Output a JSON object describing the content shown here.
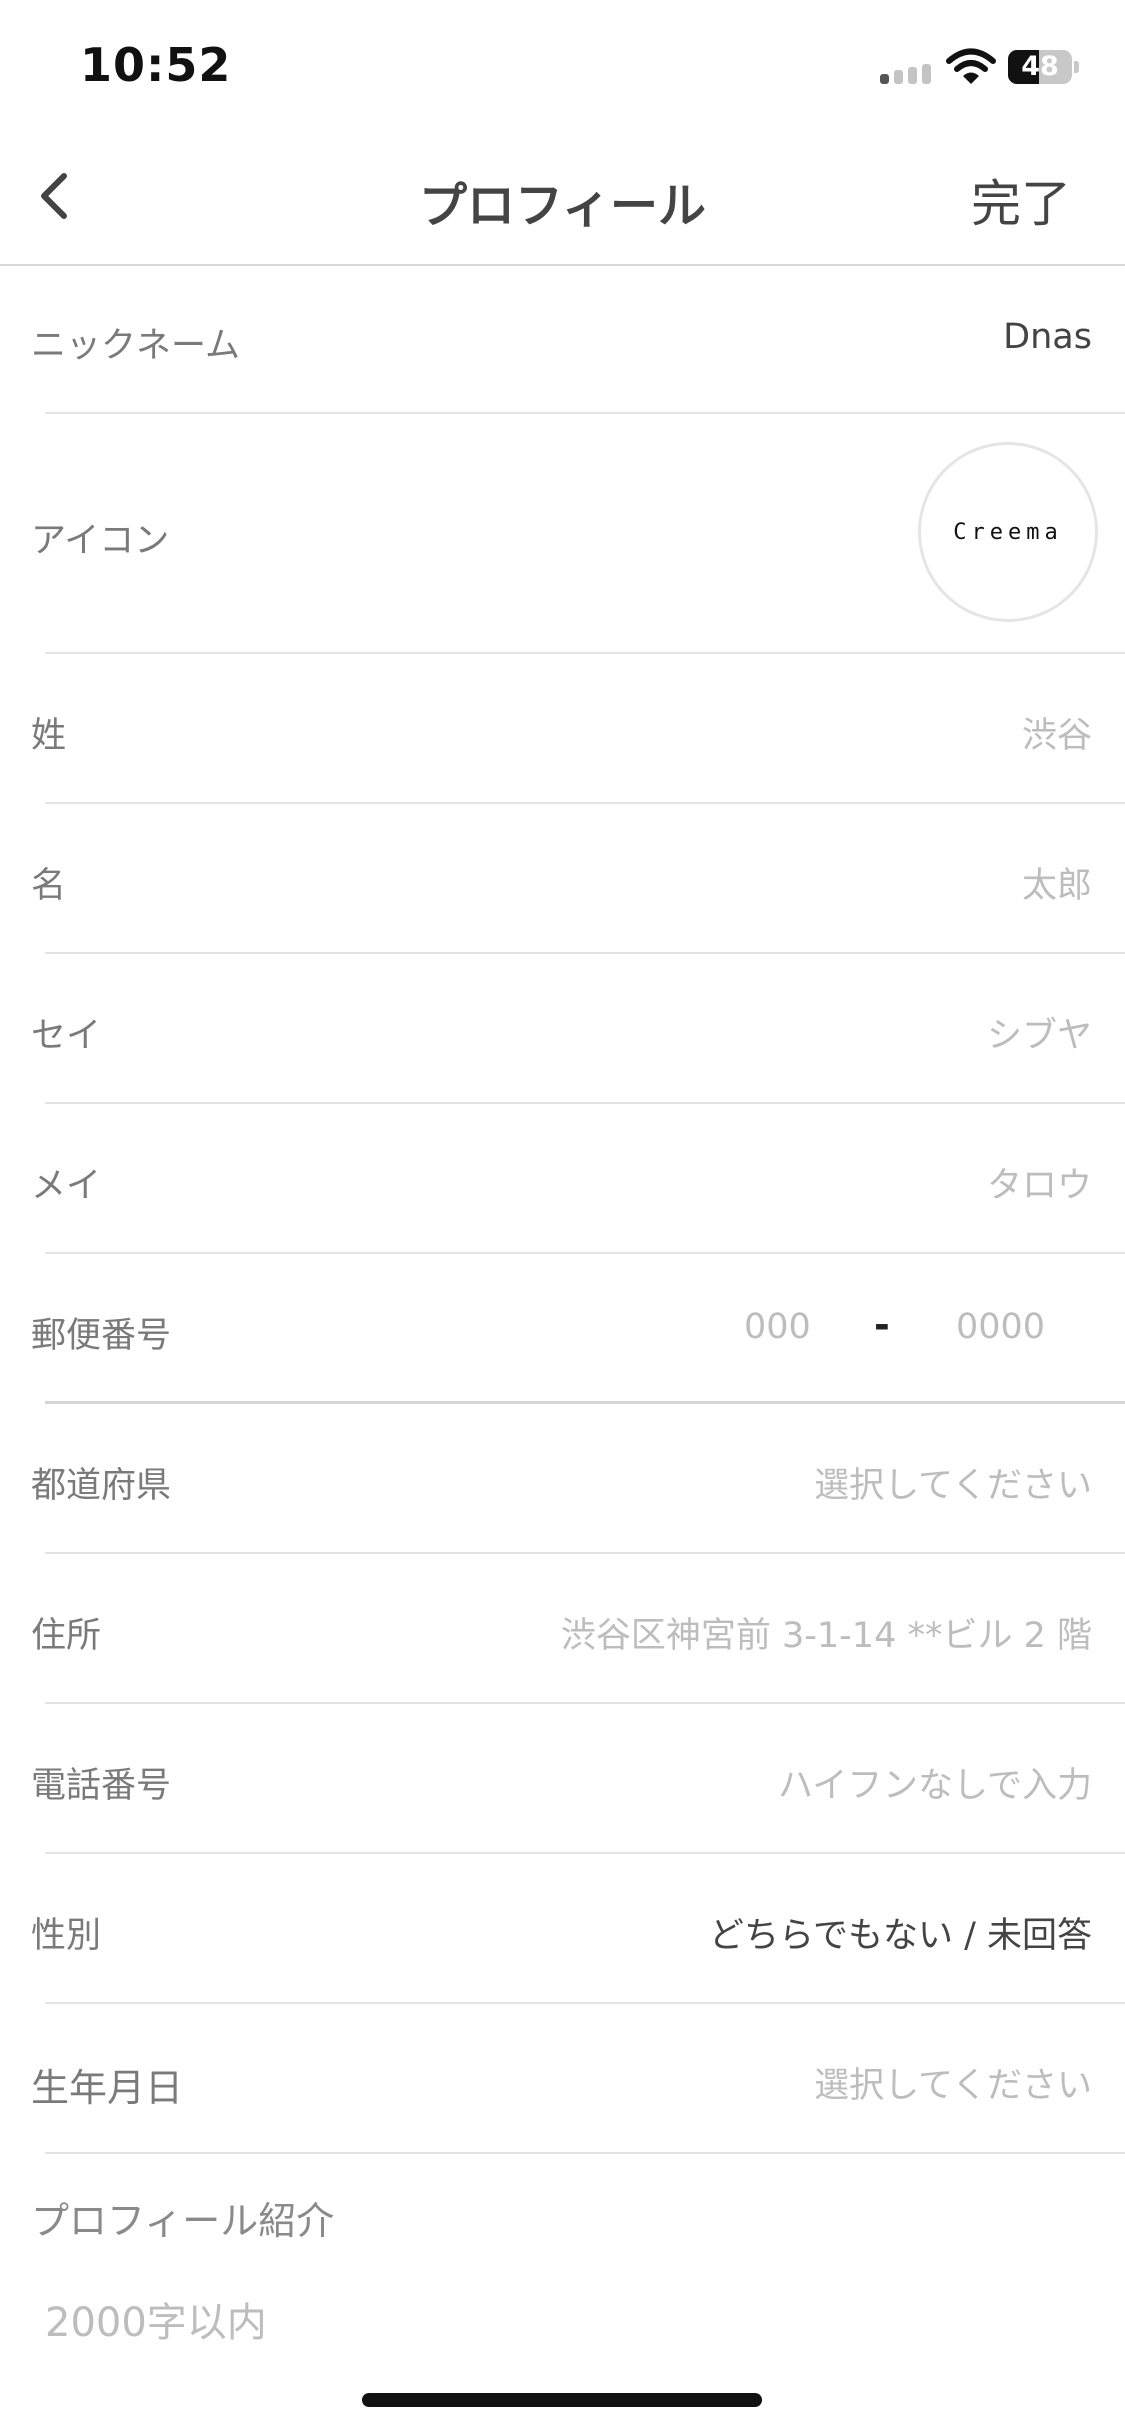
{
  "status_bar": {
    "time": "10:52",
    "battery": "48",
    "battery_level": 0.48
  },
  "nav": {
    "title": "プロフィール",
    "done_label": "完了"
  },
  "fields": {
    "nickname": {
      "label": "ニックネーム",
      "value": "Dnas"
    },
    "icon": {
      "label": "アイコン",
      "logo_text": "Creema"
    },
    "last_name": {
      "label": "姓",
      "placeholder": "渋谷"
    },
    "first_name": {
      "label": "名",
      "placeholder": "太郎"
    },
    "last_name_kana": {
      "label": "セイ",
      "placeholder": "シブヤ"
    },
    "first_name_kana": {
      "label": "メイ",
      "placeholder": "タロウ"
    },
    "postal_code": {
      "label": "郵便番号",
      "placeholder_1": "000",
      "separator": "-",
      "placeholder_2": "0000"
    },
    "prefecture": {
      "label": "都道府県",
      "placeholder": "選択してください"
    },
    "address": {
      "label": "住所",
      "placeholder": "渋谷区神宮前 3-1-14 **ビル 2 階"
    },
    "phone": {
      "label": "電話番号",
      "placeholder": "ハイフンなしで入力"
    },
    "gender": {
      "label": "性別",
      "value": "どちらでもない / 未回答"
    },
    "birthday": {
      "label": "生年月日",
      "placeholder": "選択してください"
    },
    "bio": {
      "label": "プロフィール紹介",
      "placeholder": "2000字以内"
    }
  },
  "colors": {
    "label": "#7a7a7a",
    "placeholder": "#bdbdbd",
    "value": "#444444",
    "separator": "#e3e3e3"
  }
}
